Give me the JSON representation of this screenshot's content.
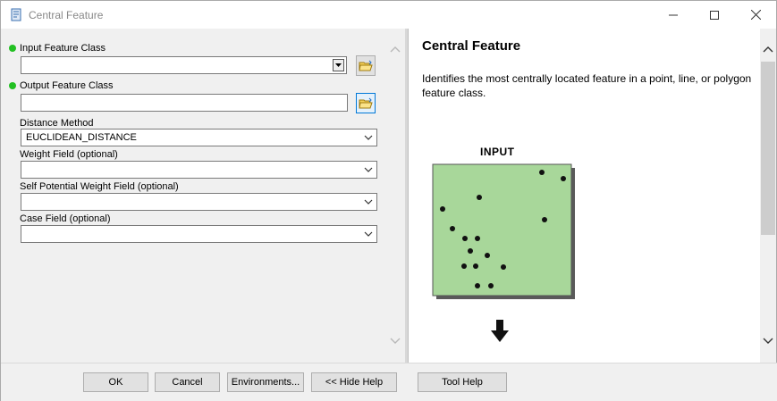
{
  "window": {
    "title": "Central Feature"
  },
  "form": {
    "input_feature_class": {
      "label": "Input Feature Class",
      "value": ""
    },
    "output_feature_class": {
      "label": "Output Feature Class",
      "value": ""
    },
    "distance_method": {
      "label": "Distance Method",
      "value": "EUCLIDEAN_DISTANCE"
    },
    "weight_field": {
      "label": "Weight Field (optional)",
      "value": ""
    },
    "self_potential_weight_field": {
      "label": "Self Potential Weight Field (optional)",
      "value": ""
    },
    "case_field": {
      "label": "Case Field (optional)",
      "value": ""
    }
  },
  "help": {
    "title": "Central Feature",
    "description": "Identifies the most centrally located feature in a point, line, or polygon feature class.",
    "diagram_label": "INPUT"
  },
  "buttons": {
    "ok": "OK",
    "cancel": "Cancel",
    "environments": "Environments...",
    "hide_help": "<< Hide Help",
    "tool_help": "Tool Help"
  },
  "colors": {
    "required_dot": "#22c022",
    "diagram_fill": "#a8d79a",
    "folder_active_border": "#0078d7"
  },
  "icons": {
    "app": "toolbox-script-icon",
    "folder": "open-folder-icon",
    "minimize": "minimize-icon",
    "maximize": "maximize-icon",
    "close": "close-icon"
  }
}
